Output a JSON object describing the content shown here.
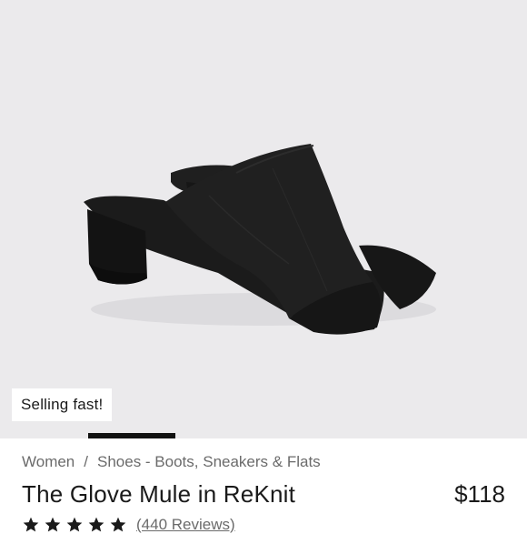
{
  "product_image": {
    "alt": "The Glove Mule in ReKnit",
    "badge": "Selling fast!"
  },
  "carousel": {
    "active_index": 2,
    "count": 6
  },
  "breadcrumb": {
    "items": [
      "Women",
      "Shoes - Boots, Sneakers & Flats"
    ],
    "separator": "/"
  },
  "product": {
    "title": "The Glove Mule in ReKnit",
    "price": "$118",
    "rating": 5,
    "reviews_label": "(440 Reviews)"
  },
  "colors": {
    "background": "#ebeaec",
    "text": "#1a1a1a",
    "muted_text": "#6b6b6b",
    "indicator": "#111111"
  }
}
